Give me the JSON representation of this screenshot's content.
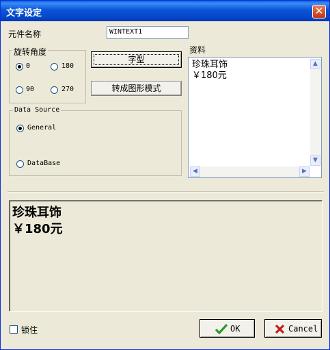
{
  "window": {
    "title": "文字设定",
    "close_glyph": "✕"
  },
  "component": {
    "label": "元件名称",
    "value": "WINTEXT1"
  },
  "rotation": {
    "label": "旋转角度",
    "options": [
      "0",
      "180",
      "90",
      "270"
    ],
    "selected": "0"
  },
  "buttons": {
    "font": "字型",
    "to_graphic": "转成图形模式",
    "ok": "OK",
    "cancel": "Cancel"
  },
  "data_source": {
    "label": "Data Source",
    "options": [
      "General",
      "DataBase"
    ],
    "selected": "General"
  },
  "data_panel": {
    "label": "资料",
    "lines": [
      "珍珠耳饰",
      "￥180元"
    ]
  },
  "preview": {
    "lines": [
      "珍珠耳饰",
      "￥180元"
    ]
  },
  "lock": {
    "label": "锁住",
    "checked": false
  },
  "colors": {
    "ok_check": "#2a9a2a",
    "cancel_x": "#c0201a",
    "title_bar": "#0a55d8"
  }
}
